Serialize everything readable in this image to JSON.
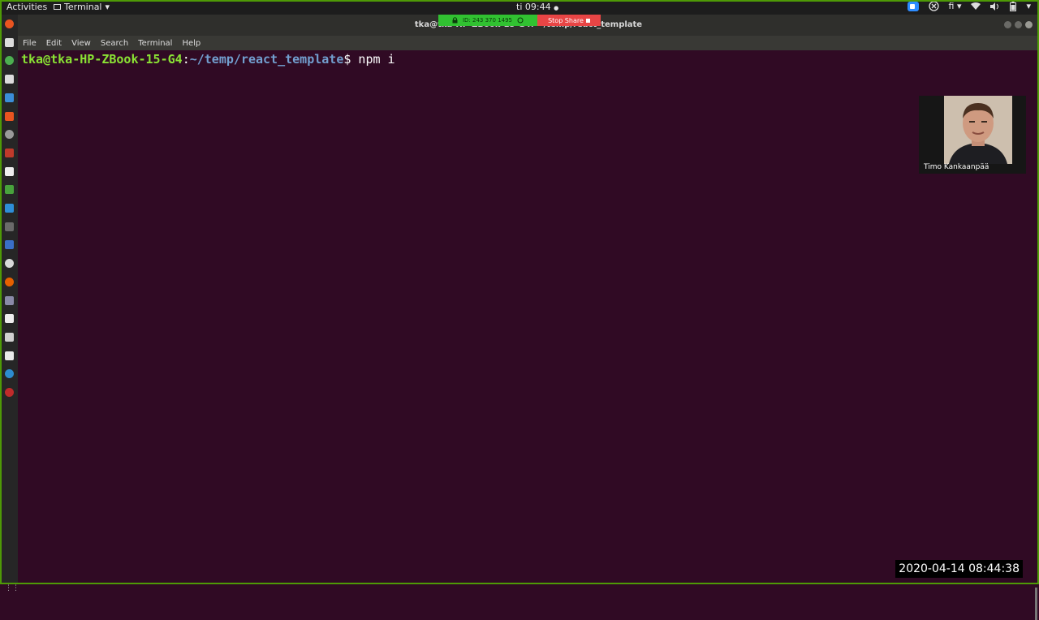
{
  "topbar": {
    "activities": "Activities",
    "app_name": "Terminal",
    "app_arrow": "▾",
    "clock": "ti 09:44",
    "clock_dot": "●",
    "keyboard_layout": "fi",
    "icons": [
      "zoom-icon",
      "network-disconnect-icon",
      "wifi-icon",
      "volume-icon",
      "battery-icon",
      "power-menu-icon"
    ]
  },
  "share_bar": {
    "meeting_id": "ID: 243 370 1495",
    "stop_label": "Stop Share"
  },
  "window": {
    "title": "tka@tka-HP-ZBook-15-G4: ~/temp/react_template",
    "menu": [
      "File",
      "Edit",
      "View",
      "Search",
      "Terminal",
      "Help"
    ]
  },
  "terminal": {
    "user_host": "tka@tka-HP-ZBook-15-G4",
    "separator": ":",
    "path": "~/temp/react_template",
    "dollar": "$",
    "command": " npm i"
  },
  "webcam": {
    "participant_name": "Timo Kankaanpää"
  },
  "overlay": {
    "timestamp": "2020-04-14 08:44:38"
  },
  "dock": {
    "items": [
      {
        "icon": "ubuntu-logo-icon",
        "color": "#e95420"
      },
      {
        "icon": "terminal-app-icon",
        "color": "#dcdcdc"
      },
      {
        "icon": "chrome-icon",
        "color": "#4caf50"
      },
      {
        "icon": "document-icon",
        "color": "#dcdcdc"
      },
      {
        "icon": "writer-icon",
        "color": "#3b8ed8"
      },
      {
        "icon": "store-icon",
        "color": "#e95420"
      },
      {
        "icon": "settings-icon",
        "color": "#9a9a9a"
      },
      {
        "icon": "filezilla-icon",
        "color": "#bf3a2b"
      },
      {
        "icon": "bag-icon",
        "color": "#eeeeee"
      },
      {
        "icon": "sheet-icon",
        "color": "#48a33c"
      },
      {
        "icon": "vscode-icon",
        "color": "#2e8ed8"
      },
      {
        "icon": "active-terminal-icon",
        "color": "#6a6a6a"
      },
      {
        "icon": "blue-app-icon",
        "color": "#3a6fc8"
      },
      {
        "icon": "chromium-icon",
        "color": "#d9d9d9"
      },
      {
        "icon": "firefox-icon",
        "color": "#e66000"
      },
      {
        "icon": "diamond-app-icon",
        "color": "#8a8aa8"
      },
      {
        "icon": "file-icon",
        "color": "#eeeeee"
      },
      {
        "icon": "triangle-app-icon",
        "color": "#d0d0d0"
      },
      {
        "icon": "mail-icon",
        "color": "#e9e9e9"
      },
      {
        "icon": "globe-icon",
        "color": "#2d8ccf"
      },
      {
        "icon": "red-app-icon",
        "color": "#c02b2b"
      }
    ],
    "show_apps_icon": "⋮⋮"
  }
}
